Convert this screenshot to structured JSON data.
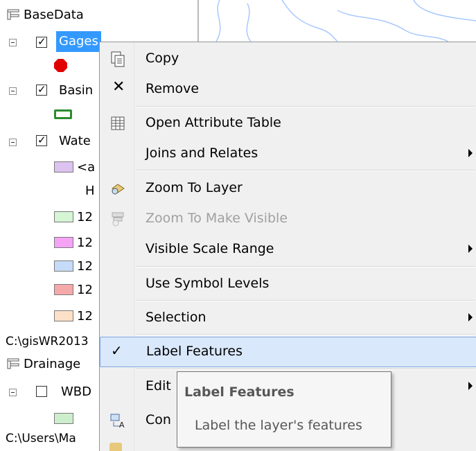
{
  "toc": {
    "basedata_label": "BaseData",
    "gages_label": "Gages",
    "basins_label": "Basin",
    "watershed_label": "Wate",
    "all_other_label": "<a",
    "all_other_sub": "H",
    "class_labels": [
      "12",
      "12",
      "12",
      "12",
      "12"
    ],
    "class_colors": [
      "#d5f5d5",
      "#f5a3f5",
      "#c6dbf7",
      "#f5a9a9",
      "#fde0c8"
    ],
    "path1": "C:\\gisWR2013",
    "drainage_label": "Drainage",
    "wbd_label": "WBD",
    "path2": "C:\\Users\\Ma"
  },
  "menu": {
    "copy": "Copy",
    "remove": "Remove",
    "open_attribute_table": "Open Attribute Table",
    "joins_relates": "Joins and Relates",
    "zoom_to_layer": "Zoom To Layer",
    "zoom_to_visible": "Zoom To Make Visible",
    "visible_scale_range": "Visible Scale Range",
    "use_symbol_levels": "Use Symbol Levels",
    "selection": "Selection",
    "label_features": "Label Features",
    "edit": "Edit",
    "convert": "Con"
  },
  "tooltip": {
    "title": "Label Features",
    "body": "Label the layer's features"
  },
  "colors": {
    "selected_layer_bg": "#3399ff",
    "highlight_bg": "#d9e8fb",
    "menu_bg": "#f0f0f0"
  }
}
